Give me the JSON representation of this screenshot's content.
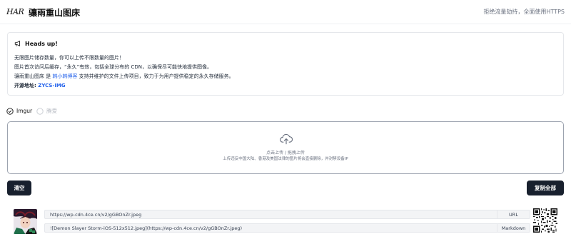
{
  "header": {
    "logo": "HAR",
    "title": "骧雨重山图床",
    "tagline": "拒绝流量劫持，全面使用HTTPS"
  },
  "notice": {
    "title": "Heads up!",
    "line1": "无限图片储存数量，你可以上传不限数量的图片！",
    "line2": "图片首次访问后缓存，“永久”有效，包括全球分布的 CDN，以确保尽可能快地提供图像。",
    "line3_pre": "骧雨重山图床 是 ",
    "line3_link": "韩小韩博客",
    "line3_post": " 支持并维护的文件上传项目，致力于为用户提供稳定的永久存储服务。",
    "line4_label": "开源地址: ",
    "line4_link": "ZYCS-IMG"
  },
  "hosts": {
    "option1": "Imgur",
    "option2": "腾爱"
  },
  "upload": {
    "main": "点击上传 / 拖拽上传",
    "sub": "上传违反中国大陆、香港及美国法律的图片将会直接删除，并封禁设备IP"
  },
  "actions": {
    "clear": "清空",
    "copy_all": "复制全部"
  },
  "result": {
    "url": "https://wp-cdn.4ce.cn/v2/gGBOnZr.jpeg",
    "url_tag": "URL",
    "markdown": "![Demon Slayer Storm-iOS-512x512.jpeg](https://wp-cdn.4ce.cn/v2/gGBOnZr.jpeg)",
    "markdown_tag": "Markdown"
  }
}
